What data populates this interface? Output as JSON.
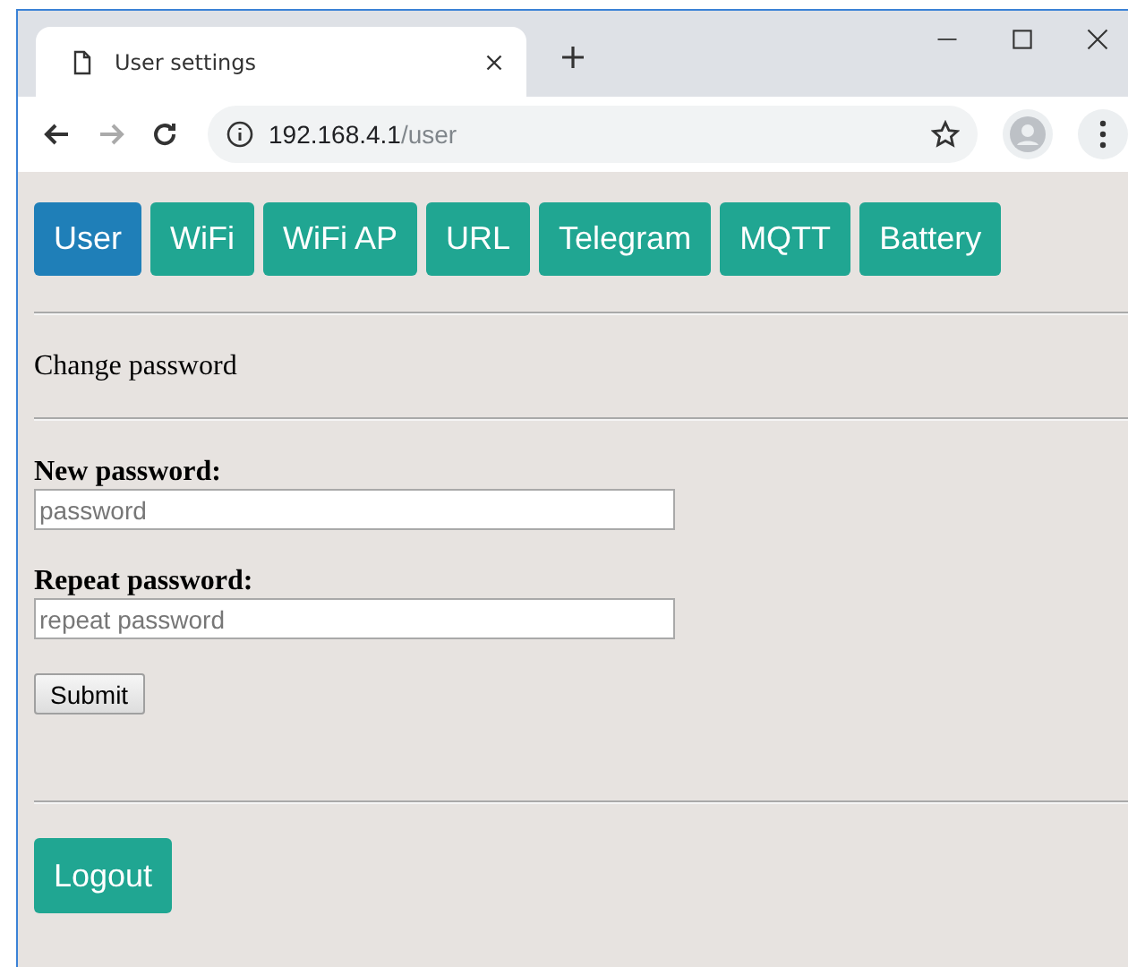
{
  "browser": {
    "tab_title": "User settings",
    "url_host": "192.168.4.1",
    "url_path": "/user",
    "forward_disabled": true
  },
  "nav": [
    {
      "label": "User",
      "selected": true
    },
    {
      "label": "WiFi",
      "selected": false
    },
    {
      "label": "WiFi AP",
      "selected": false
    },
    {
      "label": "URL",
      "selected": false
    },
    {
      "label": "Telegram",
      "selected": false
    },
    {
      "label": "MQTT",
      "selected": false
    },
    {
      "label": "Battery",
      "selected": false
    }
  ],
  "section_title": "Change password",
  "fields": [
    {
      "label": "New password:",
      "placeholder": "password"
    },
    {
      "label": "Repeat password:",
      "placeholder": "repeat password"
    }
  ],
  "submit": "Submit",
  "logout": "Logout"
}
